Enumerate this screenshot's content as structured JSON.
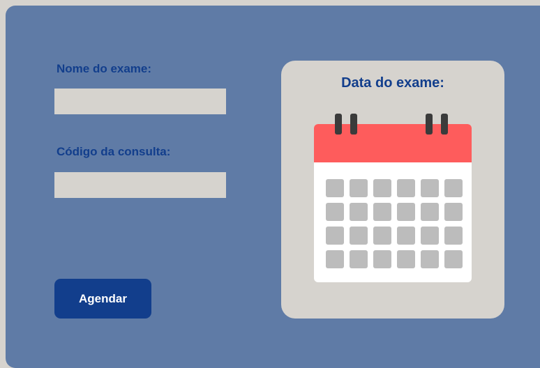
{
  "form": {
    "exam_name_label": "Nome do exame:",
    "exam_name_value": "",
    "appointment_code_label": "Código da consulta:",
    "appointment_code_value": "",
    "submit_label": "Agendar"
  },
  "date_panel": {
    "title": "Data do exame:",
    "calendar_icon": "calendar-icon",
    "grid_rows": 4,
    "grid_columns": 6
  },
  "colors": {
    "background": "#d6d3ce",
    "card": "#5f7ba6",
    "accent": "#123e8c",
    "calendar_header": "#fe5c5c",
    "calendar_cell": "#bcbcbc"
  }
}
